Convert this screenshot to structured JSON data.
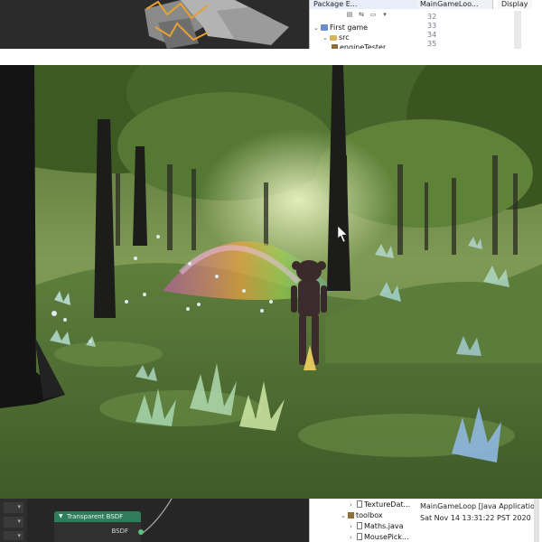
{
  "ide_top": {
    "package_explorer_tab": "Package E...",
    "tree": [
      {
        "label": "First game",
        "kind": "project"
      },
      {
        "label": "src",
        "kind": "folder"
      },
      {
        "label": "engineTester",
        "kind": "package"
      }
    ],
    "editor_tabs": [
      "MainGameLoo...",
      "Display"
    ],
    "line_numbers": [
      "32",
      "33",
      "34",
      "35"
    ]
  },
  "node_editor": {
    "node_title": "Transparent BSDF",
    "node_output": "BSDF"
  },
  "ide_bottom": {
    "files": [
      "TextureDat...",
      "toolbox",
      "Maths.java",
      "MousePick..."
    ],
    "console_title": "MainGameLoop [Java Application] C:\\",
    "console_timestamp": "Sat Nov 14 13:31:22 PST 2020"
  },
  "colors": {
    "node_header": "#2f7d5b",
    "grass": "#5a7a3e",
    "sky_glow": "#d9e6a8"
  }
}
